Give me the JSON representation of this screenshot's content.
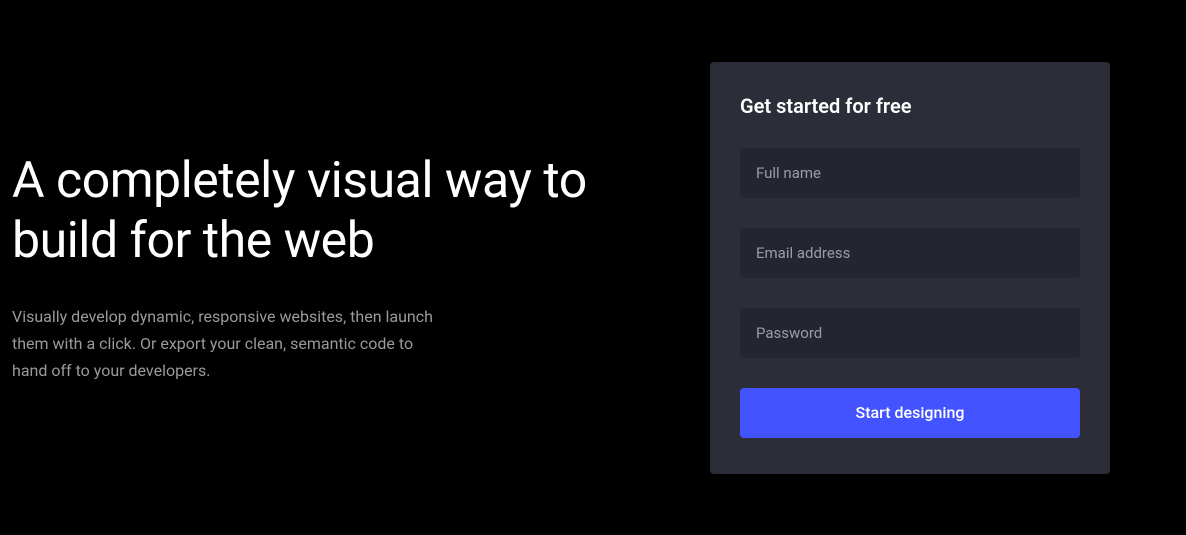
{
  "hero": {
    "heading": "A completely visual way to build for the web",
    "description": "Visually develop dynamic, responsive websites, then launch them with a click. Or export your clean, semantic code to hand off to your developers."
  },
  "signup": {
    "title": "Get started for free",
    "fields": {
      "fullname": {
        "placeholder": "Full name",
        "value": ""
      },
      "email": {
        "placeholder": "Email address",
        "value": ""
      },
      "password": {
        "placeholder": "Password",
        "value": ""
      }
    },
    "submit_label": "Start designing"
  },
  "colors": {
    "background": "#000000",
    "card_bg": "#2b2e38",
    "input_bg": "#232530",
    "accent": "#4353ff",
    "text_primary": "#ffffff",
    "text_secondary": "#9a9a9a"
  }
}
